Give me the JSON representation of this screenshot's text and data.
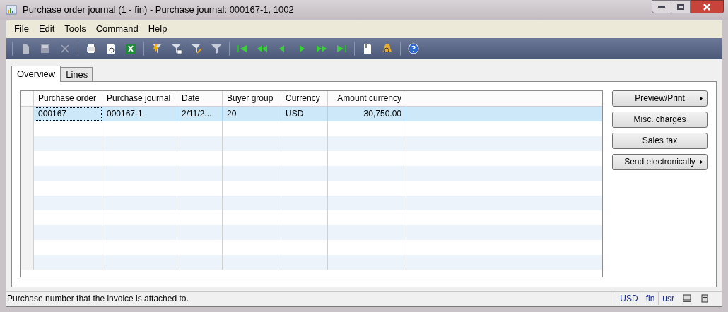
{
  "window": {
    "title": "Purchase order journal (1 - fin) - Purchase journal: 000167-1, 1002"
  },
  "menu": [
    "File",
    "Edit",
    "Tools",
    "Command",
    "Help"
  ],
  "tabs": [
    {
      "label": "Overview",
      "selected": true
    },
    {
      "label": "Lines",
      "selected": false
    }
  ],
  "table": {
    "columns": [
      "Purchase order",
      "Purchase journal",
      "Date",
      "Buyer group",
      "Currency",
      "Amount currency"
    ],
    "rows": [
      {
        "selected": true,
        "cells": [
          "000167",
          "000167-1",
          "2/11/2...",
          "20",
          "USD",
          "30,750.00"
        ]
      }
    ]
  },
  "buttons": [
    {
      "label": "Preview/Print",
      "menu": true
    },
    {
      "label": "Misc. charges",
      "menu": false
    },
    {
      "label": "Sales tax",
      "menu": false
    },
    {
      "label": "Send electronically",
      "menu": true
    }
  ],
  "status_bar": {
    "message": "Purchase number that the invoice is attached to.",
    "fields": [
      "USD",
      "fin",
      "usr"
    ]
  }
}
